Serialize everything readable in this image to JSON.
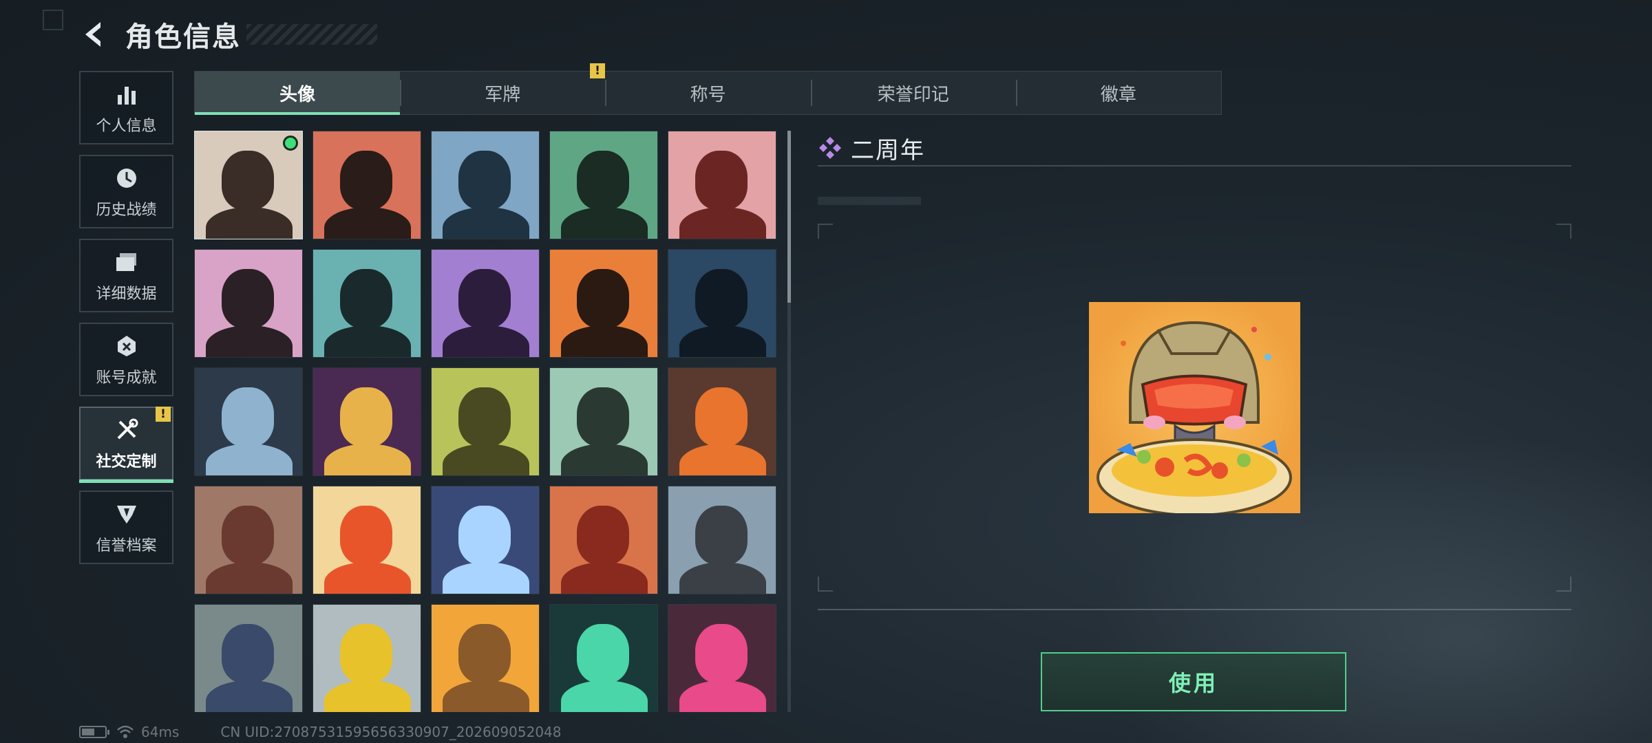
{
  "header": {
    "title": "角色信息",
    "back_icon": "back-arrow-icon"
  },
  "nav": {
    "items": [
      {
        "label": "个人信息",
        "icon": "bar-chart-icon",
        "active": false,
        "warning": false
      },
      {
        "label": "历史战绩",
        "icon": "history-clock-icon",
        "active": false,
        "warning": false
      },
      {
        "label": "详细数据",
        "icon": "folders-icon",
        "active": false,
        "warning": false
      },
      {
        "label": "账号成就",
        "icon": "achievement-icon",
        "active": false,
        "warning": false
      },
      {
        "label": "社交定制",
        "icon": "tools-icon",
        "active": true,
        "warning": true
      },
      {
        "label": "信誉档案",
        "icon": "reputation-icon",
        "active": false,
        "warning": false
      }
    ],
    "warning_symbol": "!"
  },
  "tabs": {
    "items": [
      {
        "label": "头像",
        "active": true
      },
      {
        "label": "军牌",
        "active": false
      },
      {
        "label": "称号",
        "active": false
      },
      {
        "label": "荣誉印记",
        "active": false
      },
      {
        "label": "徽章",
        "active": false
      }
    ],
    "warning_symbol": "!"
  },
  "avatars": [
    {
      "name": "avatar-portrait-photo",
      "bg": "#d9cbbb",
      "fg": "#3a2c26",
      "equipped": true
    },
    {
      "name": "avatar-cap-soldier",
      "bg": "#d9725a",
      "fg": "#2a1c18"
    },
    {
      "name": "avatar-pilot-headset",
      "bg": "#7fa6c4",
      "fg": "#1f3343"
    },
    {
      "name": "avatar-green-headset",
      "bg": "#5fa784",
      "fg": "#1a2c24"
    },
    {
      "name": "avatar-red-helmet",
      "bg": "#e3a3a6",
      "fg": "#6b2624"
    },
    {
      "name": "avatar-white-hair",
      "bg": "#d8a3c6",
      "fg": "#2a2026"
    },
    {
      "name": "avatar-bearded-glasses",
      "bg": "#6ab2b2",
      "fg": "#1a2a2c"
    },
    {
      "name": "avatar-purple-pilot",
      "bg": "#a27fd1",
      "fg": "#2c1d3d"
    },
    {
      "name": "avatar-masked-fighter",
      "bg": "#ea7f3a",
      "fg": "#2a1a12"
    },
    {
      "name": "avatar-night-gunner",
      "bg": "#2b4864",
      "fg": "#0f1a24"
    },
    {
      "name": "avatar-sniper-rifle",
      "bg": "#2c3a4a",
      "fg": "#8fb2cf"
    },
    {
      "name": "avatar-book-card",
      "bg": "#4a2a52",
      "fg": "#e8b24a"
    },
    {
      "name": "avatar-exit-door",
      "bg": "#b8c45a",
      "fg": "#4a4a22"
    },
    {
      "name": "avatar-signpost",
      "bg": "#9cc9b3",
      "fg": "#2a3a32"
    },
    {
      "name": "avatar-feather",
      "bg": "#5a3a2e",
      "fg": "#e8742e"
    },
    {
      "name": "avatar-scales-emblem",
      "bg": "#a07868",
      "fg": "#6a3a30"
    },
    {
      "name": "avatar-fries-mascot",
      "bg": "#f2d69a",
      "fg": "#e8552a"
    },
    {
      "name": "avatar-lightning-tech",
      "bg": "#3a4a78",
      "fg": "#a8d4ff"
    },
    {
      "name": "avatar-redhead-woman",
      "bg": "#d9744a",
      "fg": "#8a2a1e"
    },
    {
      "name": "avatar-mountain-view",
      "bg": "#8aa0b0",
      "fg": "#3a4046"
    },
    {
      "name": "avatar-archer",
      "bg": "#7a8a8a",
      "fg": "#3a4a6a"
    },
    {
      "name": "avatar-alligator-sign",
      "bg": "#b0bcc0",
      "fg": "#e8c22a"
    },
    {
      "name": "avatar-cartoon-hero",
      "bg": "#f2a63a",
      "fg": "#8a5a2a"
    },
    {
      "name": "avatar-alan-walker",
      "bg": "#1a3a3a",
      "fg": "#4ad6a8"
    },
    {
      "name": "avatar-hooded-rogue",
      "bg": "#4a2a3a",
      "fg": "#e84a8a"
    }
  ],
  "detail": {
    "title": "二周年",
    "icon": "diamond-cluster-icon",
    "desc": ""
  },
  "use_button": {
    "label": "使用"
  },
  "status": {
    "ping": "64ms",
    "uid": "CN UID:27087531595656330907_202609052048",
    "battery_level": 0.55
  }
}
